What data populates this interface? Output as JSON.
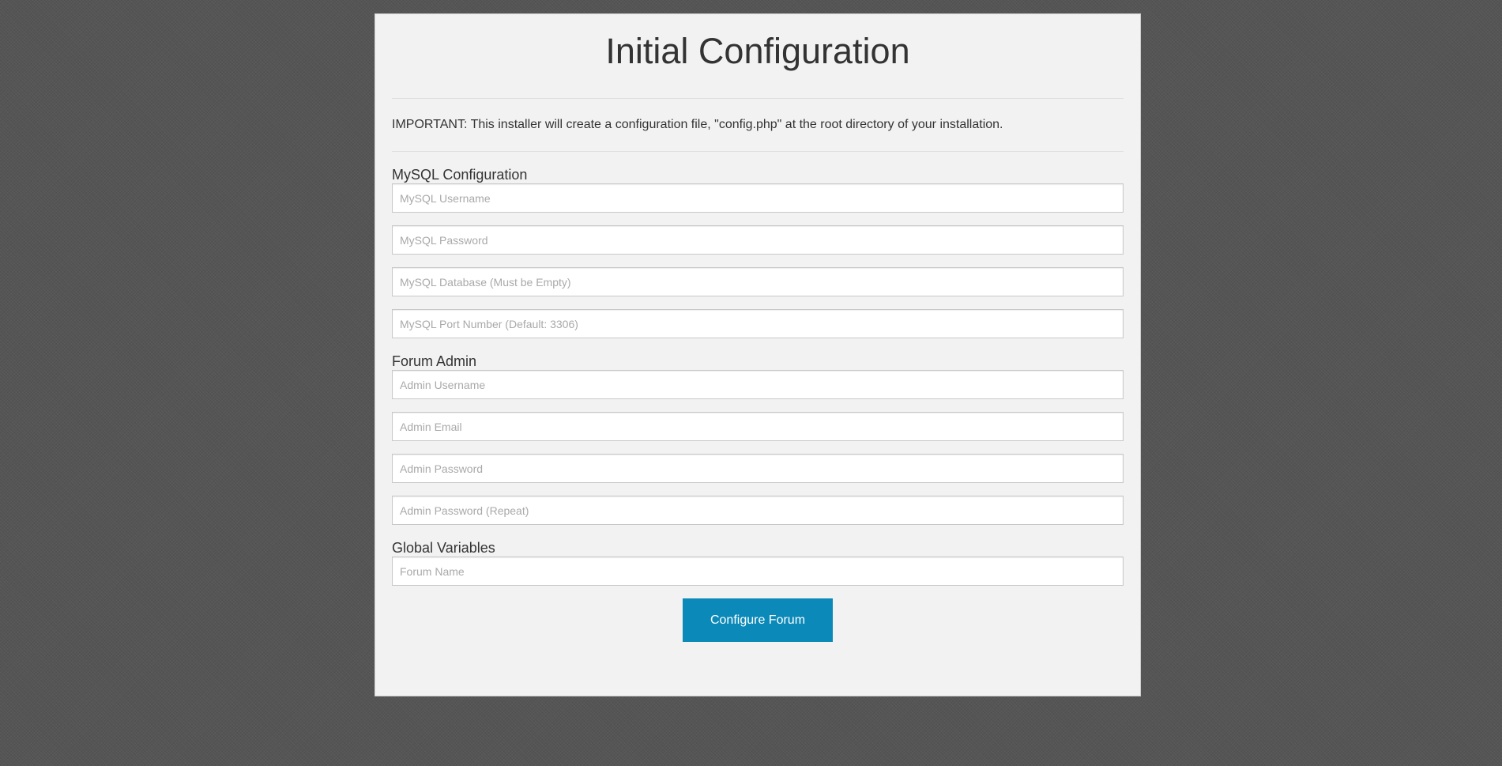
{
  "page": {
    "title": "Initial Configuration",
    "notice": "IMPORTANT: This installer will create a configuration file, \"config.php\" at the root directory of your installation."
  },
  "mysql": {
    "heading": "MySQL Configuration",
    "username_placeholder": "MySQL Username",
    "password_placeholder": "MySQL Password",
    "database_placeholder": "MySQL Database (Must be Empty)",
    "port_placeholder": "MySQL Port Number (Default: 3306)"
  },
  "admin": {
    "heading": "Forum Admin",
    "username_placeholder": "Admin Username",
    "email_placeholder": "Admin Email",
    "password_placeholder": "Admin Password",
    "password_repeat_placeholder": "Admin Password (Repeat)"
  },
  "globals": {
    "heading": "Global Variables",
    "forum_name_placeholder": "Forum Name"
  },
  "submit": {
    "label": "Configure Forum"
  },
  "colors": {
    "button": "#0b89b8",
    "panel": "#f2f2f2",
    "background": "#555555"
  }
}
